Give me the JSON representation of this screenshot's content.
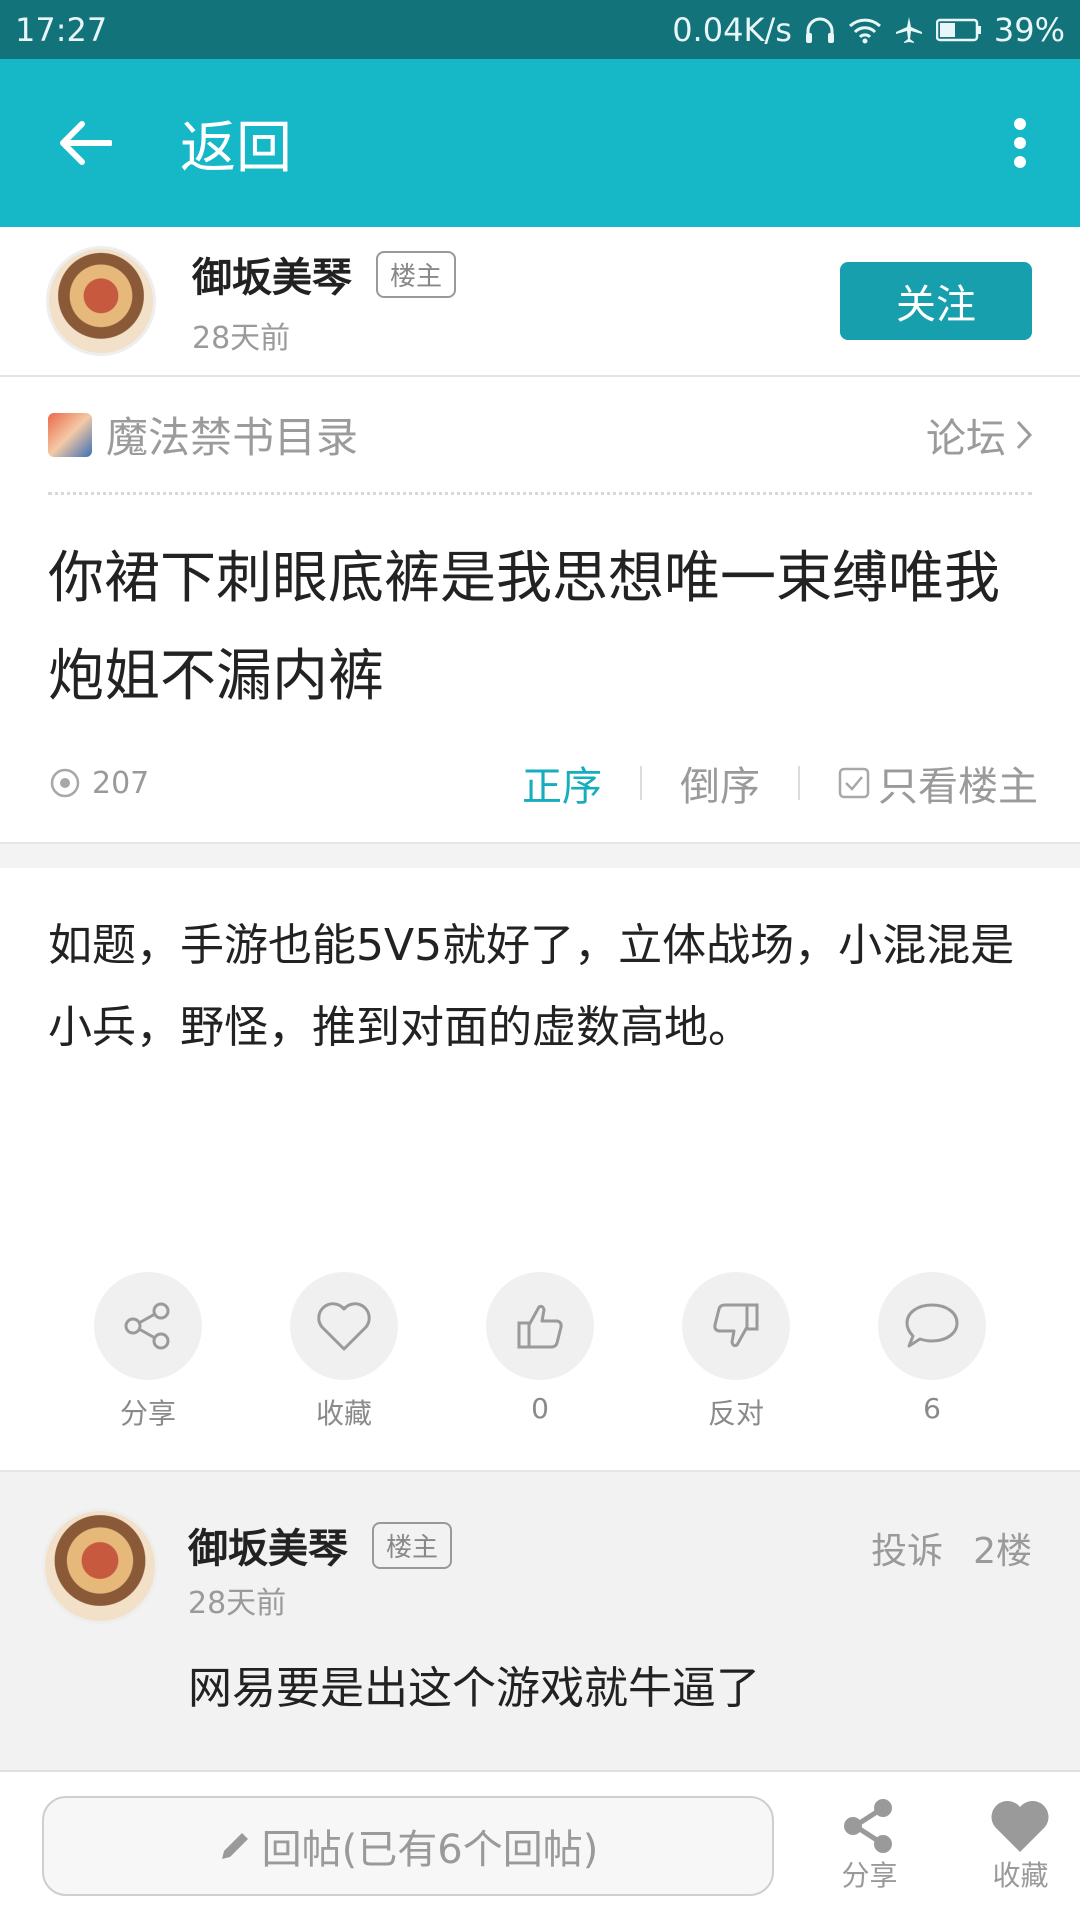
{
  "status_bar": {
    "time": "17:27",
    "net_speed": "0.04K/s",
    "battery": "39%"
  },
  "app_bar": {
    "title": "返回"
  },
  "author": {
    "name": "御坂美琴",
    "tag": "楼主",
    "time": "28天前",
    "follow_label": "关注"
  },
  "forum": {
    "name": "魔法禁书目录",
    "link_label": "论坛"
  },
  "post": {
    "title": "你裙下刺眼底裤是我思想唯一束缚唯我炮姐不漏内裤",
    "views": "207",
    "sort_asc": "正序",
    "sort_desc": "倒序",
    "only_owner": "只看楼主",
    "body": "如题，手游也能5V5就好了，立体战场，小混混是小兵，野怪，推到对面的虚数高地。"
  },
  "actions": [
    {
      "icon": "share-icon",
      "label": "分享"
    },
    {
      "icon": "heart-icon",
      "label": "收藏"
    },
    {
      "icon": "thumbs-up-icon",
      "label": "0"
    },
    {
      "icon": "thumbs-down-icon",
      "label": "反对"
    },
    {
      "icon": "comment-icon",
      "label": "6"
    }
  ],
  "reply": {
    "name": "御坂美琴",
    "tag": "楼主",
    "time": "28天前",
    "report_label": "投诉",
    "floor": "2楼",
    "content": "网易要是出这个游戏就牛逼了"
  },
  "bottom_bar": {
    "reply_placeholder": "回帖(已有6个回帖)",
    "share_label": "分享",
    "fav_label": "收藏"
  },
  "colors": {
    "status_bar": "#13737b",
    "app_bar": "#16b7c6",
    "accent": "#179fae"
  }
}
